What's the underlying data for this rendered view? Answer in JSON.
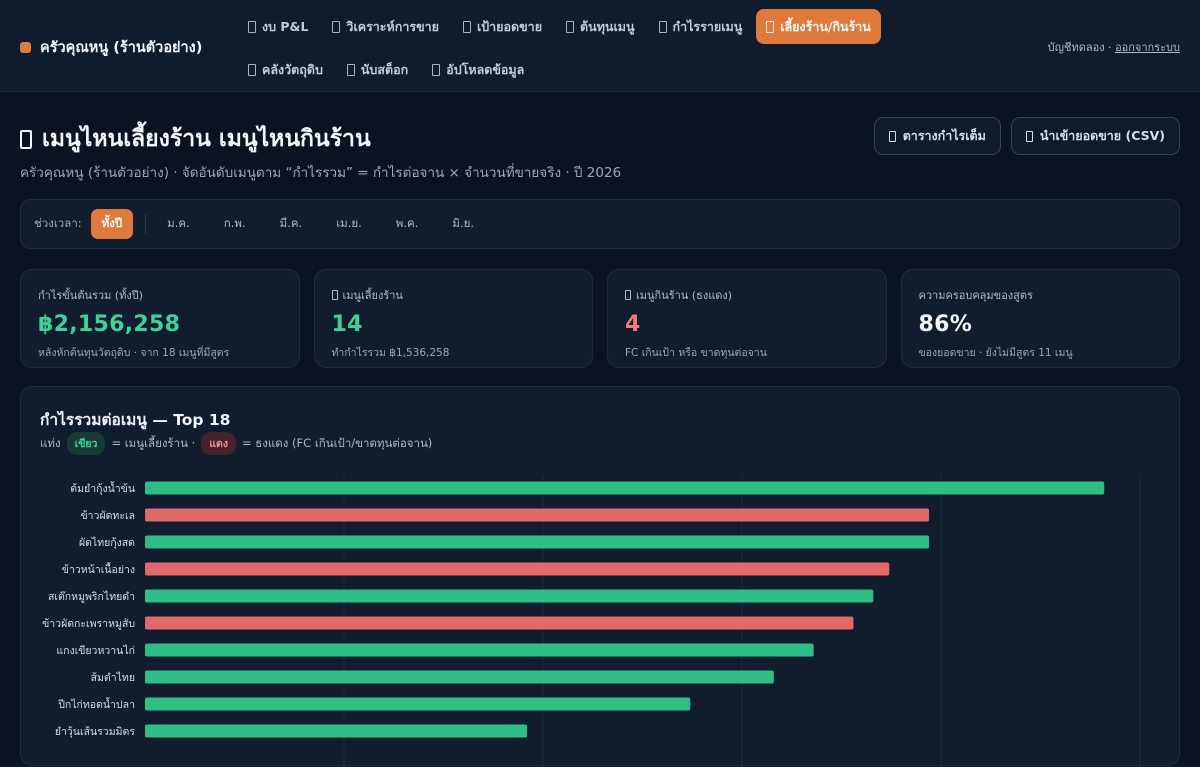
{
  "brand": {
    "name": "ครัวคุณหนู (ร้านตัวอย่าง)",
    "accent": "#e07a3c"
  },
  "nav": [
    {
      "label": "งบ P&L",
      "name": "nav-pnl",
      "active": false
    },
    {
      "label": "วิเคราะห์การขาย",
      "name": "nav-sales-analysis",
      "active": false
    },
    {
      "label": "เป้ายอดขาย",
      "name": "nav-sales-target",
      "active": false
    },
    {
      "label": "ต้นทุนเมนู",
      "name": "nav-menu-cost",
      "active": false
    },
    {
      "label": "กำไรรายเมนู",
      "name": "nav-menu-profit",
      "active": false
    },
    {
      "label": "เลี้ยงร้าน/กินร้าน",
      "name": "nav-menu-engineering",
      "active": true
    },
    {
      "label": "คลังวัตถุดิบ",
      "name": "nav-inventory",
      "active": false
    },
    {
      "label": "นับสต็อก",
      "name": "nav-stock-count",
      "active": false
    },
    {
      "label": "อัปโหลดข้อมูล",
      "name": "nav-upload",
      "active": false
    }
  ],
  "account": {
    "label": "บัญชีทดลอง",
    "separator": " · ",
    "logout": "ออกจากระบบ"
  },
  "header": {
    "title": "เมนูไหนเลี้ยงร้าน เมนูไหนกินร้าน",
    "subtitle": "ครัวคุณหนู (ร้านตัวอย่าง) · จัดอันดับเมนูตาม “กำไรรวม” = กำไรต่อจาน × จำนวนที่ขายจริง · ปี 2026",
    "btn_table": "ตารางกำไรเต็ม",
    "btn_import": "นำเข้ายอดขาย (CSV)"
  },
  "filter": {
    "label": "ช่วงเวลา:",
    "all": "ทั้งปี",
    "months": [
      "ม.ค.",
      "ก.พ.",
      "มี.ค.",
      "เม.ย.",
      "พ.ค.",
      "มิ.ย."
    ]
  },
  "kpis": [
    {
      "label": "กำไรขั้นต้นรวม (ทั้งปี)",
      "value": "฿2,156,258",
      "note": "หลังหักต้นทุนวัตถุดิบ · จาก 18 เมนูที่มีสูตร",
      "color": "#3fd19a",
      "icon": false
    },
    {
      "label": "เมนูเลี้ยงร้าน",
      "value": "14",
      "note": "ทำกำไรรวม ฿1,536,258",
      "color": "#3fd19a",
      "icon": true
    },
    {
      "label": "เมนูกินร้าน (ธงแดง)",
      "value": "4",
      "note": "FC เกินเป้า หรือ ขาดทุนต่อจาน",
      "color": "#f07a7a",
      "icon": true
    },
    {
      "label": "ความครอบคลุมของสูตร",
      "value": "86%",
      "note": "ของยอดขาย · ยังไม่มีสูตร 11 เมนู",
      "color": "#f4f6fa",
      "icon": false
    }
  ],
  "chart": {
    "title": "กำไรรวมต่อเมนู — Top 18",
    "legend_prefix": "แท่ง",
    "legend_green": "เขียว",
    "legend_green_text": "= เมนูเลี้ยงร้าน ·",
    "legend_red": "แดง",
    "legend_red_text": "= ธงแดง (FC เกินเป้า/ขาดทุนต่อจาน)",
    "colors": {
      "good": "#2fbf86",
      "bad": "#e06a6a"
    }
  },
  "chart_data": {
    "type": "bar",
    "orientation": "horizontal",
    "xlim": [
      0,
      250000
    ],
    "grid": true,
    "categories": [
      "ต้มยำกุ้งน้ำข้น",
      "ข้าวผัดทะเล",
      "ผัดไทยกุ้งสด",
      "ข้าวหน้าเนื้อย่าง",
      "สเต๊กหมูพริกไทยดำ",
      "ข้าวผัดกะเพราหมูสับ",
      "แกงเขียวหวานไก่",
      "ส้มตำไทย",
      "ปีกไก่ทอดน้ำปลา",
      "ยำวุ้นเส้นรวมมิตร"
    ],
    "values": [
      241000,
      197000,
      197000,
      187000,
      183000,
      178000,
      168000,
      158000,
      137000,
      96000
    ],
    "flags": [
      "good",
      "bad",
      "good",
      "bad",
      "good",
      "bad",
      "good",
      "good",
      "good",
      "good"
    ]
  }
}
